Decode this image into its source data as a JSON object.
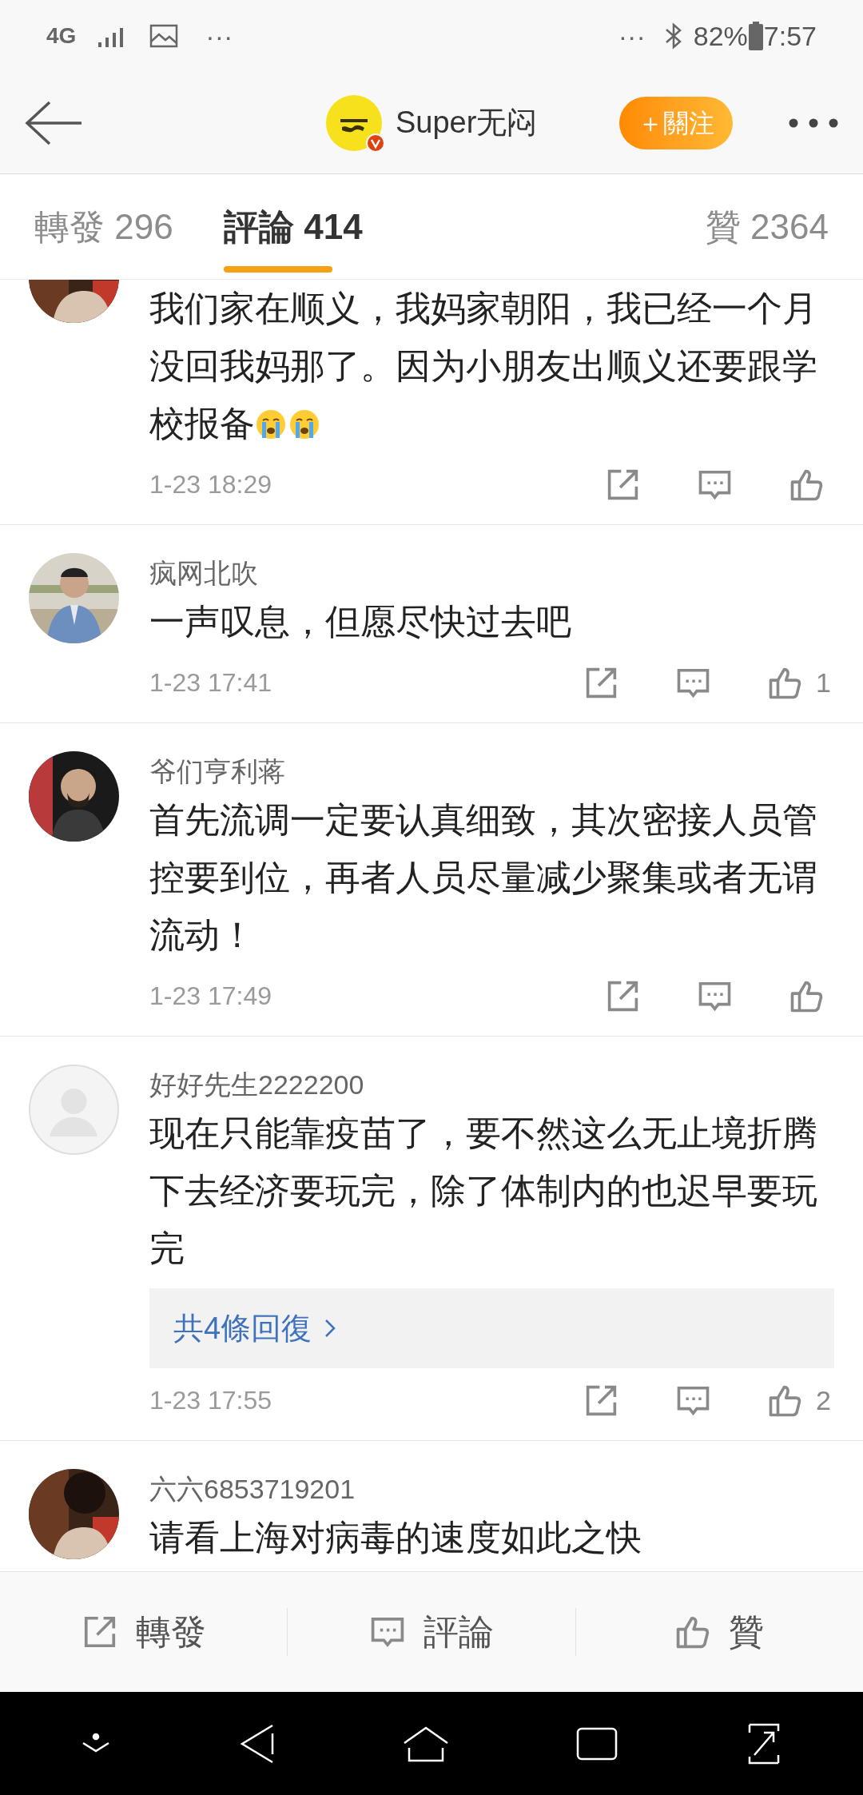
{
  "status_bar": {
    "network": "4G",
    "left_more": "···",
    "right_more": "···",
    "battery": "82%",
    "time": "7:57"
  },
  "header": {
    "title": "Super无闷",
    "follow_button": "＋關注"
  },
  "tabs": [
    {
      "label": "轉發 296",
      "selected": false
    },
    {
      "label": "評論 414",
      "selected": true
    },
    {
      "label": "贊 2364",
      "selected": false
    }
  ],
  "comments": [
    {
      "avatar": {
        "kind": "picture"
      },
      "text": "我们家在顺义，我妈家朝阳，我已经一个月没回我妈那了。因为小朋友出顺义还要跟学校报备",
      "emojis": [
        {
          "kind": "crying"
        },
        {
          "kind": "crying"
        }
      ],
      "time": "1-23 18:29"
    },
    {
      "avatar": {
        "kind": "picture"
      },
      "name": "疯网北吹",
      "text": "一声叹息，但愿尽快过去吧",
      "time": "1-23 17:41",
      "likes": "1"
    },
    {
      "avatar": {
        "kind": "picture"
      },
      "name": "爷们亨利蒋",
      "text": "首先流调一定要认真细致，其次密接人员管控要到位，再者人员尽量减少聚集或者无谓流动！",
      "time": "1-23 17:49"
    },
    {
      "avatar": {
        "kind": "default"
      },
      "name": "好好先生2222200",
      "text": "现在只能靠疫苗了，要不然这么无止境折腾下去经济要玩完，除了体制内的也迟早要玩完",
      "replies": "共4條回復",
      "time": "1-23 17:55",
      "likes": "2"
    },
    {
      "avatar": {
        "kind": "picture"
      },
      "name": "六六6853719201",
      "text": "请看上海对病毒的速度如此之快"
    }
  ],
  "action_bar": [
    {
      "kind": "repost",
      "label": "轉發"
    },
    {
      "kind": "comment",
      "label": "評論"
    },
    {
      "kind": "like",
      "label": "贊"
    }
  ]
}
